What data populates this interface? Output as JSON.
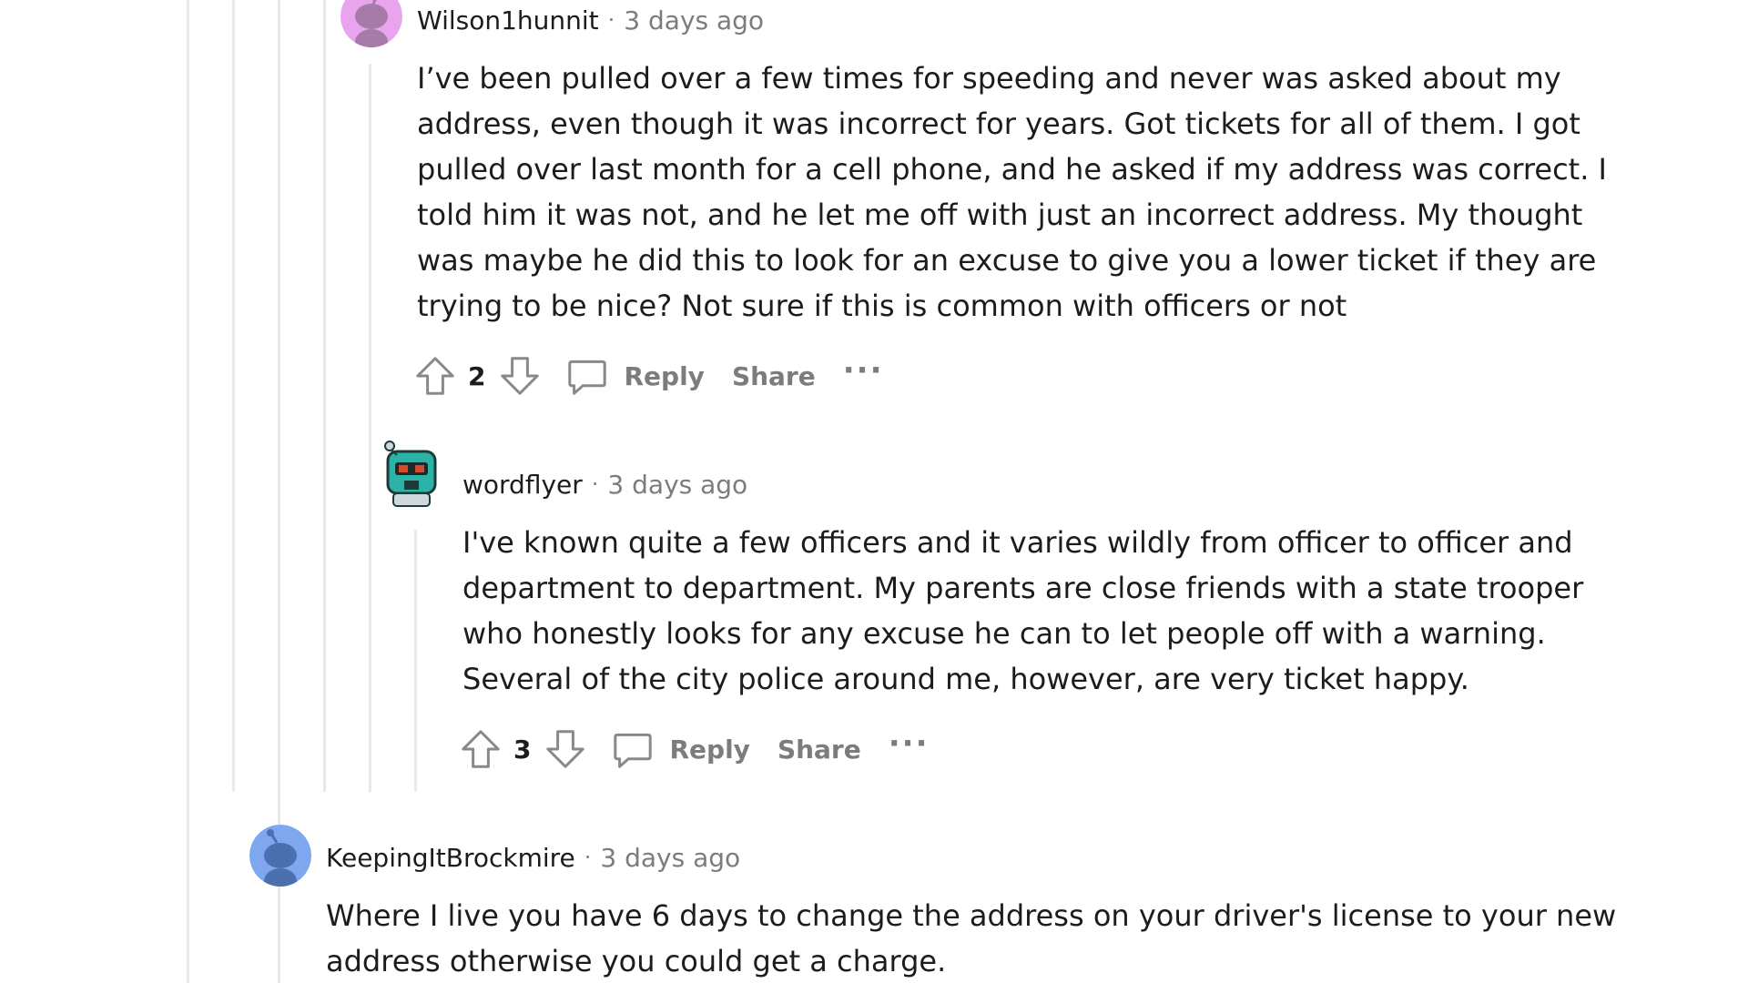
{
  "comments": [
    {
      "author": "Wilson1hunnit",
      "separator": "·",
      "time": "3 days ago",
      "body_lines": [
        "I’ve been pulled over a few times for speeding and never was asked about my",
        "address, even though it was incorrect for years. Got tickets for all of them. I got",
        "pulled over last month for a cell phone, and he asked if my address was correct. I",
        "told him it was not, and he let me off with just an incorrect address. My thought",
        "was maybe he did this to look for an excuse to give you a lower ticket if they are",
        "trying to be nice? Not sure if this is common with officers or not"
      ],
      "votes": "2",
      "reply_label": "Reply",
      "share_label": "Share",
      "more_label": "···",
      "avatar_color": "#e8a5ee"
    },
    {
      "author": "wordflyer",
      "separator": "·",
      "time": "3 days ago",
      "body_lines": [
        "I've known quite a few officers and it varies wildly from officer to officer and",
        "department to department. My parents are close friends with a state trooper",
        "who honestly looks for any excuse he can to let people off with a warning.",
        "Several of the city police around me, however, are very ticket happy."
      ],
      "votes": "3",
      "reply_label": "Reply",
      "share_label": "Share",
      "more_label": "···",
      "avatar_color": "#2bb3a6"
    },
    {
      "author": "KeepingItBrockmire",
      "separator": "·",
      "time": "3 days ago",
      "body_lines": [
        "Where I live you have 6 days to change the address on your driver's license to your new",
        "address otherwise you could get a charge."
      ],
      "avatar_color": "#7fa7f0"
    }
  ],
  "icons": {
    "upvote": "arrow-up-outline",
    "downvote": "arrow-down-outline",
    "reply": "speech-bubble-outline",
    "more": "horizontal-ellipsis"
  },
  "colors": {
    "text": "#1c1c1c",
    "muted": "#7c7c7c",
    "thread_line": "#e7eaec"
  }
}
